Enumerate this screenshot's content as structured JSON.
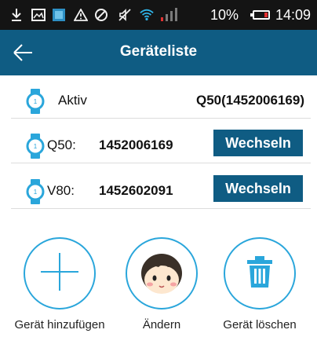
{
  "status_bar": {
    "icons": [
      "download-icon",
      "image-icon",
      "app-icon",
      "alert-icon",
      "sync-icon",
      "mute-icon",
      "wifi-icon",
      "signal-icon"
    ],
    "battery_percent": "10%",
    "time": "14:09",
    "battery_color": "#e23030"
  },
  "app_bar": {
    "title": "Geräteliste",
    "back_icon": "arrow-left-icon",
    "color": "#0f5c83"
  },
  "active": {
    "label": "Aktiv",
    "value": "Q50(1452006169)"
  },
  "devices": [
    {
      "model": "Q50:",
      "id": "1452006169",
      "button": "Wechseln"
    },
    {
      "model": "V80:",
      "id": "1452602091",
      "button": "Wechseln"
    }
  ],
  "actions": [
    {
      "label": "Gerät hinzufügen",
      "icon": "plus-icon"
    },
    {
      "label": "Ändern",
      "icon": "avatar-icon"
    },
    {
      "label": "Gerät löschen",
      "icon": "trash-icon"
    }
  ],
  "accent_color": "#2aa6db"
}
